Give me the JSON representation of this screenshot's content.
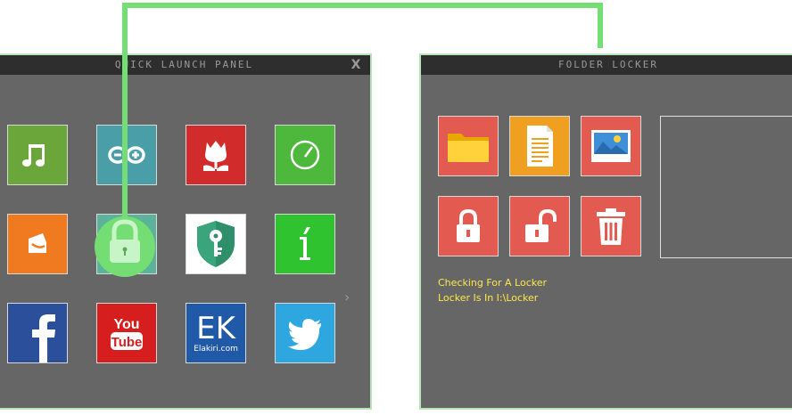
{
  "left_panel": {
    "title": "QUICK LAUNCH PANEL",
    "close_label": "X",
    "next_label": "›",
    "tiles": [
      {
        "icon": "music-icon",
        "color": "#6ba63a"
      },
      {
        "icon": "arduino-icon",
        "color": "#4a9ea8"
      },
      {
        "icon": "tulip-icon",
        "color": "#d22b2b"
      },
      {
        "icon": "speedometer-icon",
        "color": "#4db83c"
      },
      {
        "icon": "wallet-icon",
        "color": "#f07a20"
      },
      {
        "icon": "lock-icon",
        "color": "#5ab39a"
      },
      {
        "icon": "key-shield-icon",
        "color": "#ffffff"
      },
      {
        "icon": "i-letter-icon",
        "color": "#2fc42f"
      },
      {
        "icon": "facebook-icon",
        "color": "#2c4f9c"
      },
      {
        "icon": "youtube-icon",
        "color": "#d71e1e"
      },
      {
        "icon": "elakiri-icon",
        "color": "#1f59a8",
        "text": "EK",
        "subtext": "Elakiri.com"
      },
      {
        "icon": "twitter-icon",
        "color": "#2ea7e0"
      }
    ]
  },
  "right_panel": {
    "title": "FOLDER LOCKER",
    "tiles": [
      {
        "icon": "folder-icon",
        "color": "#e35a50"
      },
      {
        "icon": "document-icon",
        "color": "#f0a020"
      },
      {
        "icon": "image-icon",
        "color": "#e35a50"
      },
      {
        "icon": "locked-padlock-icon",
        "color": "#e35a50"
      },
      {
        "icon": "unlocked-padlock-icon",
        "color": "#e35a50"
      },
      {
        "icon": "trash-icon",
        "color": "#e35a50"
      }
    ],
    "status": {
      "line1": "Checking For A Locker",
      "line2": "Locker Is In I:\\Locker"
    }
  }
}
